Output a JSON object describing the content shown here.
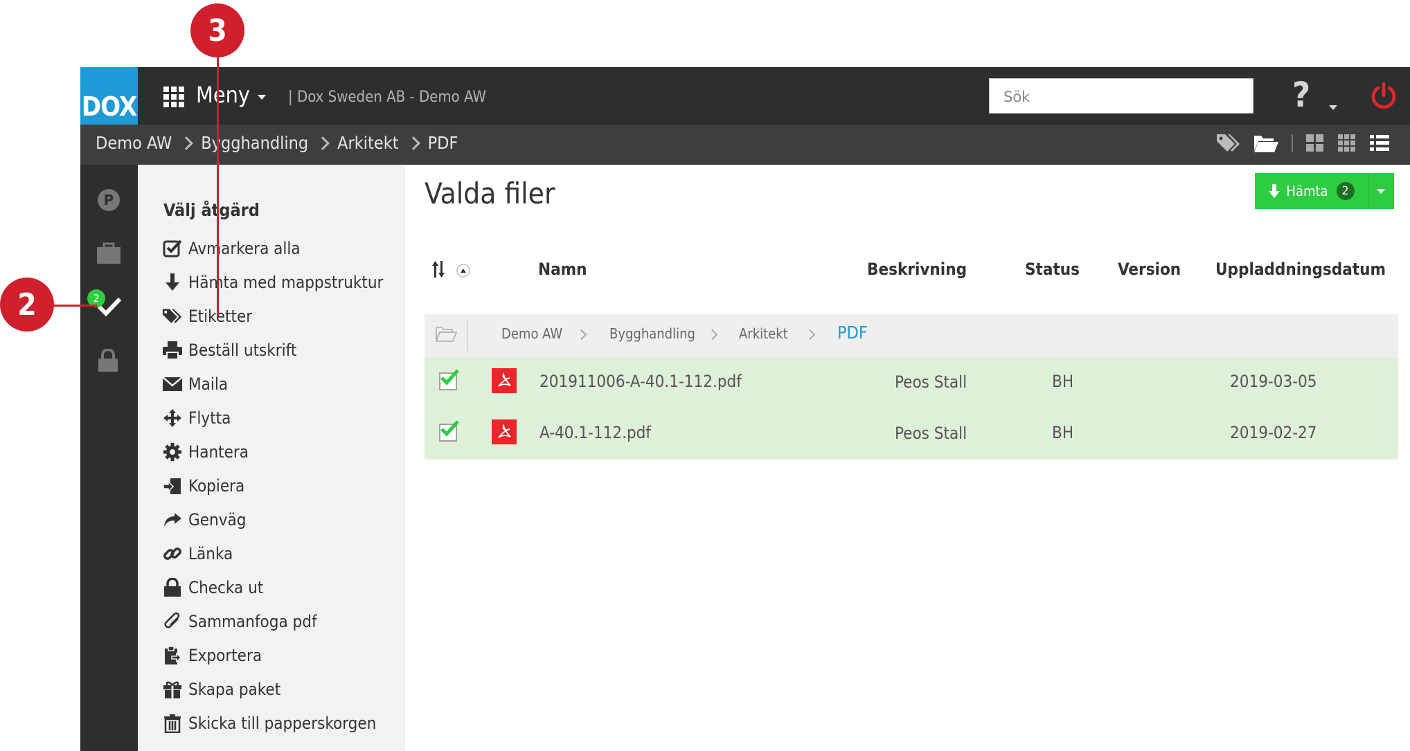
{
  "header": {
    "logo_text": "DOX",
    "menu_label": "Meny",
    "company": "| Dox Sweden AB - Demo AW",
    "search_placeholder": "Sök",
    "help_symbol": "?"
  },
  "breadcrumb": [
    "Demo AW",
    "Bygghandling",
    "Arkitekt",
    "PDF"
  ],
  "sidebar": {
    "selected_count": "2",
    "items": [
      "p-icon",
      "briefcase-icon",
      "check-icon",
      "lock-icon"
    ]
  },
  "actions": {
    "title": "Välj åtgärd",
    "items": [
      {
        "label": "Avmarkera alla",
        "icon": "check-square-icon"
      },
      {
        "label": "Hämta med mappstruktur",
        "icon": "download-icon"
      },
      {
        "label": "Etiketter",
        "icon": "tags-icon"
      },
      {
        "label": "Beställ utskrift",
        "icon": "print-icon"
      },
      {
        "label": "Maila",
        "icon": "mail-icon"
      },
      {
        "label": "Flytta",
        "icon": "move-icon"
      },
      {
        "label": "Hantera",
        "icon": "gear-icon"
      },
      {
        "label": "Kopiera",
        "icon": "copy-icon"
      },
      {
        "label": "Genväg",
        "icon": "share-icon"
      },
      {
        "label": "Länka",
        "icon": "link-icon"
      },
      {
        "label": "Checka ut",
        "icon": "lock-icon"
      },
      {
        "label": "Sammanfoga pdf",
        "icon": "paperclip-icon"
      },
      {
        "label": "Exportera",
        "icon": "clipboard-icon"
      },
      {
        "label": "Skapa paket",
        "icon": "gift-icon"
      },
      {
        "label": "Skicka till papperskorgen",
        "icon": "trash-icon"
      }
    ]
  },
  "main": {
    "title": "Valda filer",
    "download_label": "Hämta",
    "download_count": "2",
    "columns": [
      "Namn",
      "Beskrivning",
      "Status",
      "Version",
      "Uppladdningsdatum"
    ],
    "folder_path": [
      "Demo AW",
      "Bygghandling",
      "Arkitekt",
      "PDF"
    ],
    "rows": [
      {
        "name": "201911006-A-40.1-112.pdf",
        "description": "Peos Stall",
        "status": "BH",
        "date": "2019-03-05"
      },
      {
        "name": "A-40.1-112.pdf",
        "description": "Peos Stall",
        "status": "BH",
        "date": "2019-02-27"
      }
    ]
  },
  "callouts": {
    "left": "2",
    "top": "3"
  },
  "colors": {
    "accent": "#1e9bd7",
    "success": "#2ecc40",
    "callout": "#d01f2d",
    "selected_row": "#dff0d8"
  }
}
